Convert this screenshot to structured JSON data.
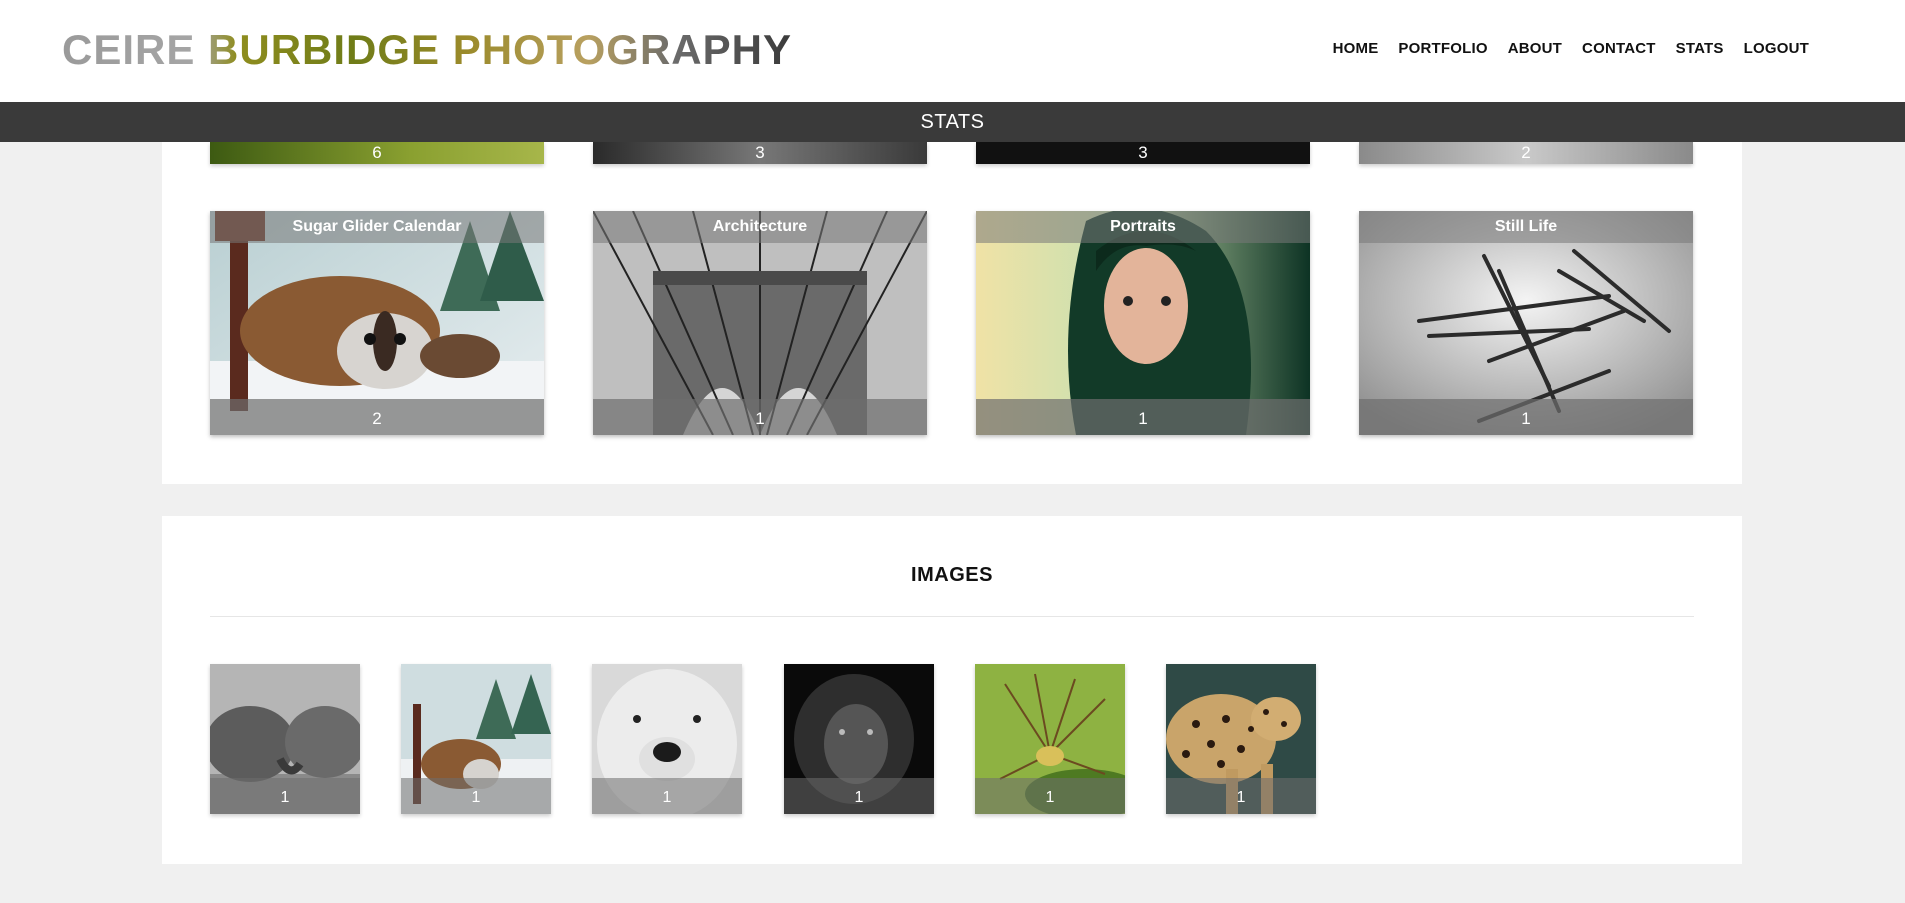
{
  "header": {
    "logo": "CEIRE BURBIDGE PHOTOGRAPHY",
    "nav": [
      "HOME",
      "PORTFOLIO",
      "ABOUT",
      "CONTACT",
      "STATS",
      "LOGOUT"
    ]
  },
  "statsbar": {
    "label": "STATS"
  },
  "top_row_partial_counts": [
    "6",
    "3",
    "3",
    "2"
  ],
  "categories": [
    {
      "title": "Sugar Glider Calendar",
      "count": "2",
      "image": "sugar-glider-photo"
    },
    {
      "title": "Architecture",
      "count": "1",
      "image": "bridge-photo"
    },
    {
      "title": "Portraits",
      "count": "1",
      "image": "portrait-photo"
    },
    {
      "title": "Still Life",
      "count": "1",
      "image": "nails-photo"
    }
  ],
  "images_section": {
    "title": "IMAGES",
    "thumbs": [
      {
        "count": "1",
        "image": "elephants-photo"
      },
      {
        "count": "1",
        "image": "sugar-glider-photo"
      },
      {
        "count": "1",
        "image": "polar-bear-photo"
      },
      {
        "count": "1",
        "image": "lion-photo"
      },
      {
        "count": "1",
        "image": "spider-photo"
      },
      {
        "count": "1",
        "image": "leopard-photo"
      }
    ]
  }
}
